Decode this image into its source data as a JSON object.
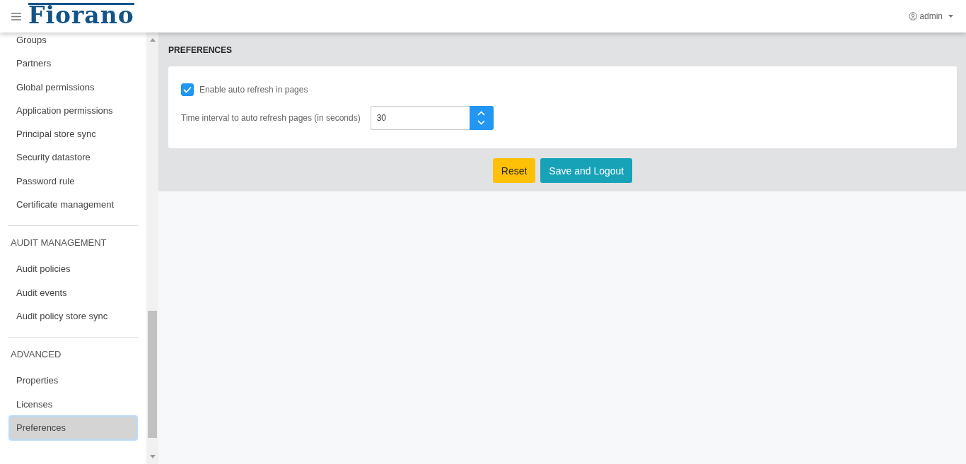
{
  "header": {
    "logo": "Fiorano",
    "user": "admin"
  },
  "sidebar": {
    "sections": [
      {
        "items": [
          {
            "label": "Groups",
            "selected": false
          },
          {
            "label": "Partners",
            "selected": false
          },
          {
            "label": "Global permissions",
            "selected": false
          },
          {
            "label": "Application permissions",
            "selected": false
          },
          {
            "label": "Principal store sync",
            "selected": false
          },
          {
            "label": "Security datastore",
            "selected": false
          },
          {
            "label": "Password rule",
            "selected": false
          },
          {
            "label": "Certificate management",
            "selected": false
          }
        ]
      },
      {
        "heading": "AUDIT MANAGEMENT",
        "items": [
          {
            "label": "Audit policies",
            "selected": false
          },
          {
            "label": "Audit events",
            "selected": false
          },
          {
            "label": "Audit policy store sync",
            "selected": false
          }
        ]
      },
      {
        "heading": "ADVANCED",
        "items": [
          {
            "label": "Properties",
            "selected": false
          },
          {
            "label": "Licenses",
            "selected": false
          },
          {
            "label": "Preferences",
            "selected": true
          }
        ]
      }
    ]
  },
  "page": {
    "title": "PREFERENCES",
    "auto_refresh": {
      "label": "Enable auto refresh in pages",
      "checked": true
    },
    "interval": {
      "label": "Time interval to auto refresh pages (in seconds)",
      "value": "30"
    },
    "buttons": [
      {
        "label": "Reset",
        "kind": "warning"
      },
      {
        "label": "Save and Logout",
        "kind": "primary"
      }
    ]
  }
}
